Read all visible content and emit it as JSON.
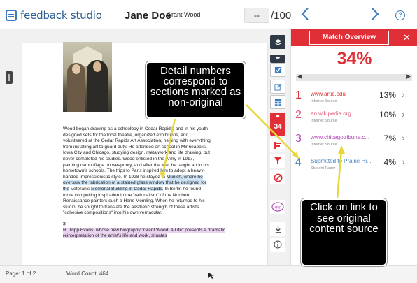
{
  "header": {
    "logo_text": "feedback studio",
    "student_name": "Jane Doe",
    "assignment_name": "Grant Wood",
    "grade_value": "--",
    "grade_total": "/100",
    "prev_icon": "chevron-left-icon",
    "next_icon": "chevron-right-icon",
    "help_icon": "help-icon",
    "help_glyph": "?"
  },
  "document": {
    "paragraph_segments": [
      {
        "text": "Wood began drawing as a schoolboy in Cedar Rapids, and in his youth designed sets for the local theatre, organized exhibitions, and volunteered at the Cedar Rapids Art Association, helping with everything from installing art to guard duty.  He attended art school in Minneapolis, Iowa City and Chicago, studying design, metalwork and life drawing, but never completed his studies. Wood enlisted in the Army in 1917, painting camouflage on weaponry, and after the war, he taught art in his hometown's schools. The trips to Paris inspired him to adopt a heavy-handed Impressionistic style.  In 1928 he stayed in ",
        "highlight": "none"
      },
      {
        "text": "Munich, where he oversaw the fabrication of a stained glass window that he designed for the",
        "highlight": "blue"
      },
      {
        "text": " Veteran's ",
        "highlight": "none"
      },
      {
        "text": "Memorial Building in Cedar Rapids.",
        "highlight": "blue"
      },
      {
        "text": " In Berlin he found more compelling inspiration in the \"rationalism\" of the Northern Renaissance painters such a Hans Memling. When he returned to his studio, he sought to translate the aesthetic strength of these artists \"cohesive compositions\" into his own vernacular.",
        "highlight": "none"
      }
    ],
    "citation_marker": "3",
    "citation_text": "R. Tripp Evans, whose new biography \"Grant Wood: A Life\" presents a dramatic reinterpretation of the artist's life and work, situates"
  },
  "toolbar": {
    "score_label": "34",
    "icons": [
      "layers-icon",
      "layers-icon",
      "checkmark-icon",
      "edit-icon",
      "grid-icon",
      "flag-icon",
      "filter-icon",
      "exclude-icon",
      "ets-icon",
      "download-icon",
      "info-icon"
    ]
  },
  "panel": {
    "title": "Match Overview",
    "close_glyph": "✕",
    "total_percent": "34%",
    "matches": [
      {
        "number": "1",
        "source": "www.artic.edu",
        "type": "Internet Source",
        "percent": "13%",
        "color": "#e02f36"
      },
      {
        "number": "2",
        "source": "en.wikipedia.org",
        "type": "Internet Source",
        "percent": "10%",
        "color": "#e0506e"
      },
      {
        "number": "3",
        "source": "www.chicagotribune.c...",
        "type": "Internet Source",
        "percent": "7%",
        "color": "#b348b7"
      },
      {
        "number": "4",
        "source": "Submitted to Prairie Hi...",
        "type": "Student Paper",
        "percent": "4%",
        "color": "#3b7cc0"
      }
    ]
  },
  "footer": {
    "page": "Page: 1 of 2",
    "word_count": "Word Count: 464"
  },
  "callouts": {
    "detail": "Detail numbers correspond to sections marked as non-original",
    "link": "Click on link to see original content source"
  },
  "colors": {
    "accent_red": "#e02f36",
    "brand_blue": "#3b7cc0",
    "highlight_blue": "#cfe3f6",
    "highlight_purple": "#ead3f1"
  }
}
